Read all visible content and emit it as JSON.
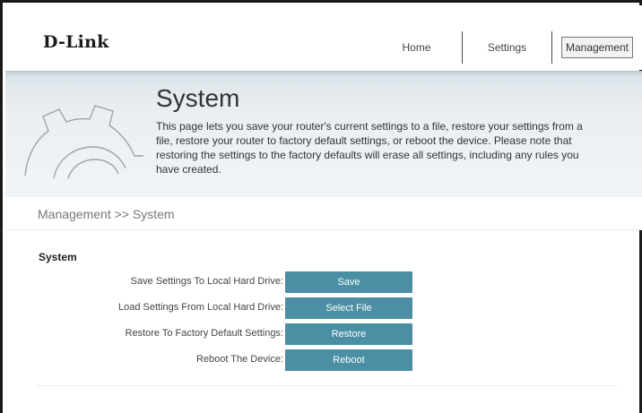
{
  "brand": {
    "logo_text": "D-Link"
  },
  "nav": {
    "items": [
      {
        "label": "Home"
      },
      {
        "label": "Settings"
      },
      {
        "label": "Management"
      }
    ]
  },
  "banner": {
    "title": "System",
    "description": "This page lets you save your router's current settings to a file, restore your settings from a file, restore your router to factory default settings, or reboot the device. Please note that restoring the settings to the factory defaults will erase all settings, including any rules you have created.",
    "icon": "gear-icon"
  },
  "breadcrumb": {
    "text": "Management >> System"
  },
  "section": {
    "title": "System",
    "rows": [
      {
        "label": "Save Settings To Local Hard Drive:",
        "button": "Save"
      },
      {
        "label": "Load Settings From Local Hard Drive:",
        "button": "Select File"
      },
      {
        "label": "Restore To Factory Default Settings:",
        "button": "Restore"
      },
      {
        "label": "Reboot The Device:",
        "button": "Reboot"
      }
    ]
  },
  "colors": {
    "button": "#4a8fa3",
    "banner": "#e9eef1"
  }
}
